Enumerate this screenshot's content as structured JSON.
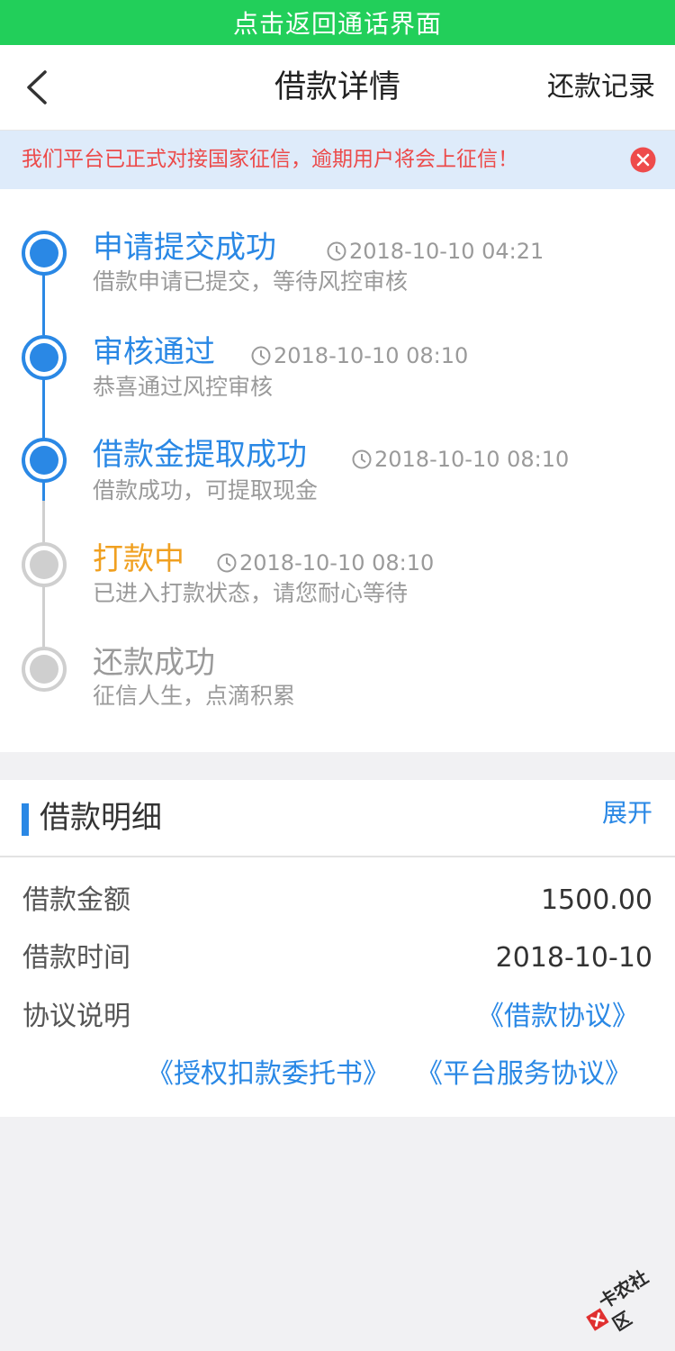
{
  "call_banner": {
    "text": "点击返回通话界面"
  },
  "navbar": {
    "title": "借款详情",
    "right_action": "还款记录"
  },
  "notice": {
    "text": "我们平台已正式对接国家征信，逾期用户将会上征信！"
  },
  "timeline": {
    "steps": [
      {
        "title": "申请提交成功",
        "time": "2018-10-10 04:21",
        "desc": "借款申请已提交，等待风控审核",
        "status": "done"
      },
      {
        "title": "审核通过",
        "time": "2018-10-10 08:10",
        "desc": "恭喜通过风控审核",
        "status": "done"
      },
      {
        "title": "借款金提取成功",
        "time": "2018-10-10 08:10",
        "desc": "借款成功，可提取现金",
        "status": "done"
      },
      {
        "title": "打款中",
        "time": "2018-10-10 08:10",
        "desc": "已进入打款状态，请您耐心等待",
        "status": "current"
      },
      {
        "title": "还款成功",
        "time": "",
        "desc": "征信人生，点滴积累",
        "status": "pending"
      }
    ]
  },
  "detail": {
    "title": "借款明细",
    "expand_label": "展开",
    "rows": [
      {
        "label": "借款金额",
        "value": "1500.00"
      },
      {
        "label": "借款时间",
        "value": "2018-10-10"
      }
    ],
    "agreement_label": "协议说明",
    "agreements": [
      "《借款协议》",
      "《授权扣款委托书》",
      "《平台服务协议》"
    ]
  },
  "watermark": {
    "text": "卡农社区"
  },
  "colors": {
    "banner_green": "#22cf5a",
    "primary_blue": "#2a88e5",
    "warning_orange": "#f0a020",
    "notice_red": "#ec4a4a",
    "notice_bg": "#deebfa"
  }
}
